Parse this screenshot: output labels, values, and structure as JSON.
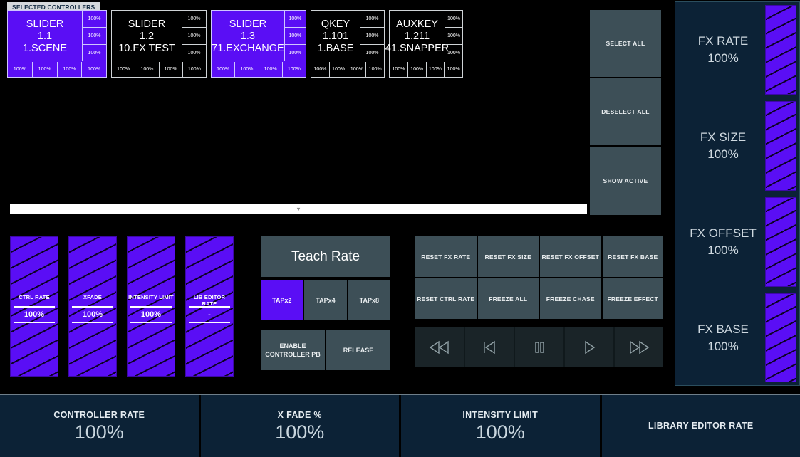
{
  "tab": {
    "label": "SELECTED CONTROLLERS"
  },
  "colors": {
    "selected_purple": "#5a0ef5",
    "button_slate": "#3d4f57",
    "panel_navy": "#0c2236",
    "panel_border": "#2b4e5e"
  },
  "controllers": [
    {
      "type": "SLIDER",
      "address": "1.1",
      "target": "1.SCENE",
      "selected": true,
      "right_values": [
        "100%",
        "100%",
        "100%"
      ],
      "bottom_values": [
        "100%",
        "100%",
        "100%",
        "100%"
      ]
    },
    {
      "type": "SLIDER",
      "address": "1.2",
      "target": "10.FX TEST",
      "selected": false,
      "right_values": [
        "100%",
        "100%",
        "100%"
      ],
      "bottom_values": [
        "100%",
        "100%",
        "100%",
        "100%"
      ]
    },
    {
      "type": "SLIDER",
      "address": "1.3",
      "target": "71.EXCHANGE",
      "selected": true,
      "right_values": [
        "100%",
        "100%",
        "100%"
      ],
      "bottom_values": [
        "100%",
        "100%",
        "100%",
        "100%"
      ]
    },
    {
      "type": "QKEY",
      "address": "1.101",
      "target": "1.BASE",
      "selected": false,
      "right_values": [
        "100%",
        "100%",
        "100%"
      ],
      "bottom_values": [
        "100%",
        "100%",
        "100%",
        "100%"
      ]
    },
    {
      "type": "AUXKEY",
      "address": "1.211",
      "target": "41.SNAPPER",
      "selected": false,
      "right_values": [
        "100%",
        "100%",
        "100%"
      ],
      "bottom_values": [
        "100%",
        "100%",
        "100%",
        "100%"
      ]
    }
  ],
  "selection_buttons": [
    {
      "label": "SELECT ALL",
      "checkbox": false
    },
    {
      "label": "DESELECT ALL",
      "checkbox": false
    },
    {
      "label": "SHOW ACTIVE",
      "checkbox": true
    }
  ],
  "scrollbar": {
    "marker_icon": "chevron-down-icon",
    "marker_glyph": "▾"
  },
  "faders": [
    {
      "label": "CTRL RATE",
      "value": "100%"
    },
    {
      "label": "XFADE",
      "value": "100%"
    },
    {
      "label": "INTENSITY LIMIT",
      "value": "100%"
    },
    {
      "label": "LIB EDITOR RATE",
      "value": "-"
    }
  ],
  "teach": {
    "title": "Teach Rate",
    "taps": [
      {
        "label": "TAPx2",
        "active": true
      },
      {
        "label": "TAPx4",
        "active": false
      },
      {
        "label": "TAPx8",
        "active": false
      }
    ],
    "enable_label": "ENABLE CONTROLLER PB",
    "release_label": "RELEASE"
  },
  "reset_grid": {
    "row1": [
      "RESET FX RATE",
      "RESET FX SIZE",
      "RESET FX OFFSET",
      "RESET FX BASE"
    ],
    "row2": [
      "RESET CTRL RATE",
      "FREEZE ALL",
      "FREEZE CHASE",
      "FREEZE EFFECT"
    ]
  },
  "transport": [
    {
      "icon": "rewind-icon"
    },
    {
      "icon": "previous-icon"
    },
    {
      "icon": "pause-icon"
    },
    {
      "icon": "play-icon"
    },
    {
      "icon": "fast-forward-icon"
    }
  ],
  "fx_panel": [
    {
      "name": "FX RATE",
      "value": "100%"
    },
    {
      "name": "FX SIZE",
      "value": "100%"
    },
    {
      "name": "FX OFFSET",
      "value": "100%"
    },
    {
      "name": "FX BASE",
      "value": "100%"
    }
  ],
  "bottom_bar": [
    {
      "label": "CONTROLLER RATE",
      "value": "100%"
    },
    {
      "label": "X FADE %",
      "value": "100%"
    },
    {
      "label": "INTENSITY LIMIT",
      "value": "100%"
    },
    {
      "label": "LIBRARY EDITOR RATE",
      "value": ""
    }
  ]
}
